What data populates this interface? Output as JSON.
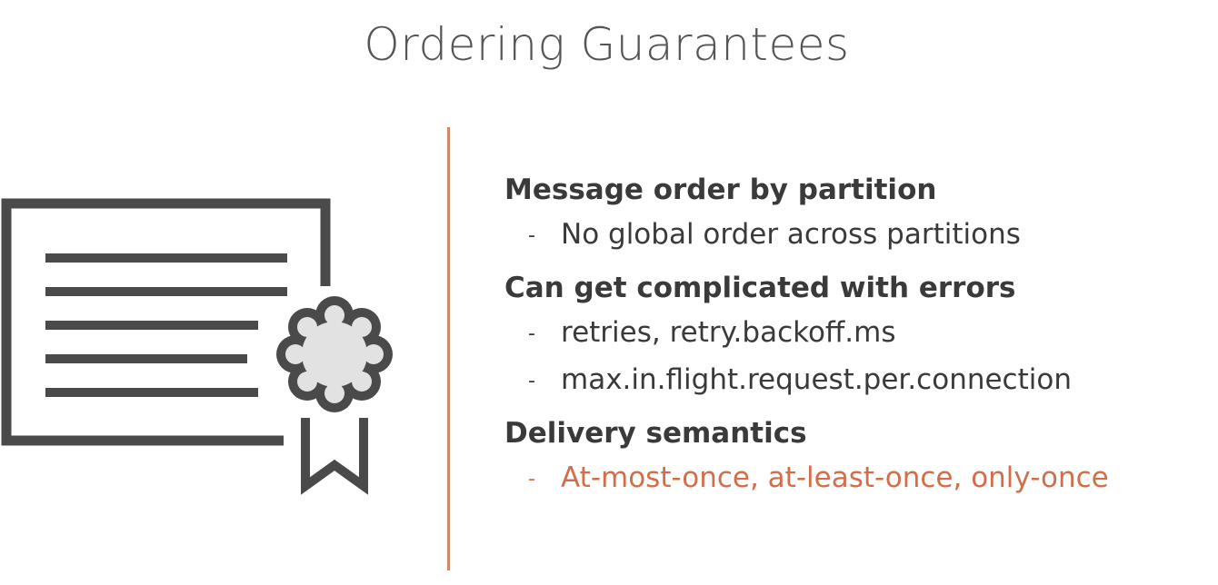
{
  "title": "Ordering Guarantees",
  "icon": "certificate-icon",
  "colors": {
    "divider": "#d0886b",
    "accent": "#d26f4a",
    "icon": "#4a4a4a",
    "seal_fill": "#e2e2e2"
  },
  "sections": [
    {
      "heading": "Message order by partition",
      "bullets": [
        "No global order across partitions"
      ]
    },
    {
      "heading": "Can get complicated with errors",
      "bullets": [
        "retries, retry.backoff.ms",
        "max.in.flight.request.per.connection"
      ]
    },
    {
      "heading": "Delivery semantics",
      "bullets": [
        "At-most-once, at-least-once, only-once"
      ]
    }
  ],
  "bullet_marker": "-"
}
